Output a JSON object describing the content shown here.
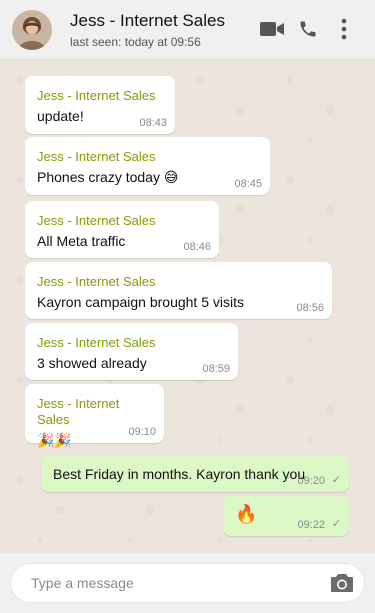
{
  "header": {
    "name": "Jess - Internet Sales",
    "status": "last seen: today at 09:56",
    "icons": [
      "video-call-icon",
      "phone-icon",
      "more-options-icon"
    ]
  },
  "messages": [
    {
      "sender": "Jess - Internet Sales",
      "text": "update!",
      "time": "08:43",
      "direction": "incoming"
    },
    {
      "sender": "Jess - Internet Sales",
      "text": "Phones crazy today 😅",
      "time": "08:45",
      "direction": "incoming"
    },
    {
      "sender": "Jess - Internet Sales",
      "text": "All Meta traffic",
      "time": "08:46",
      "direction": "incoming"
    },
    {
      "sender": "Jess - Internet Sales",
      "text": "Kayron campaign brought 5 visits",
      "time": "08:56",
      "direction": "incoming"
    },
    {
      "sender": "Jess - Internet Sales",
      "text": "3 showed already",
      "time": "08:59",
      "direction": "incoming"
    },
    {
      "sender": "Jess - Internet Sales",
      "text": "🎉🎉",
      "time": "09:10",
      "direction": "incoming"
    },
    {
      "text": "Best Friday in months. Kayron thank you",
      "time": "09:20",
      "direction": "outgoing",
      "tick": "✓"
    },
    {
      "text": "🔥",
      "time": "09:22",
      "direction": "outgoing",
      "tick": "✓"
    }
  ],
  "composer": {
    "placeholder": "Type a message"
  },
  "colors": {
    "sender": "#7ba00a",
    "outgoing_bubble": "#dcf8c6",
    "chat_bg": "#ece5dd"
  }
}
